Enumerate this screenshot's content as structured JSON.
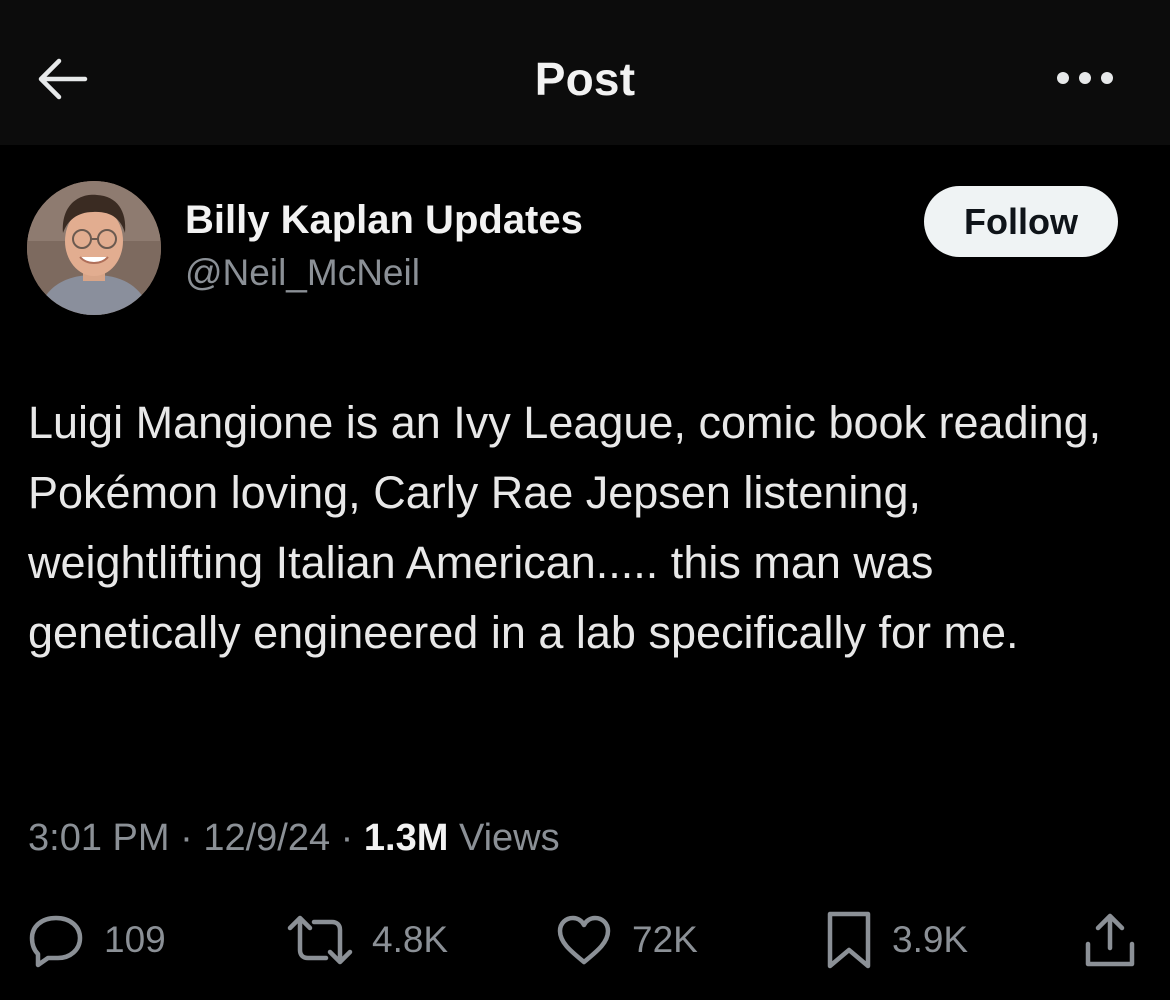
{
  "header": {
    "title": "Post",
    "back_icon": "arrow-left-icon",
    "more_icon": "more-horizontal-icon"
  },
  "author": {
    "display_name": "Billy Kaplan Updates",
    "handle": "@Neil_McNeil",
    "follow_label": "Follow"
  },
  "tweet": {
    "text": "Luigi Mangione is an Ivy League, comic book reading, Pokémon loving, Carly Rae Jepsen listening, weightlifting Italian American..... this man was genetically engineered in a lab specifically for me.",
    "time": "3:01 PM",
    "separator": "·",
    "date": "12/9/24",
    "views_count": "1.3M",
    "views_label": "Views"
  },
  "actions": {
    "replies": "109",
    "reposts": "4.8K",
    "likes": "72K",
    "bookmarks": "3.9K",
    "icons": [
      "reply-icon",
      "repost-icon",
      "like-icon",
      "bookmark-icon",
      "share-icon"
    ]
  },
  "colors": {
    "background": "#000000",
    "header_background": "#0c0c0c",
    "primary_text": "#e7e9ea",
    "secondary_text": "#8b9096",
    "follow_button_bg": "#eff3f4"
  }
}
